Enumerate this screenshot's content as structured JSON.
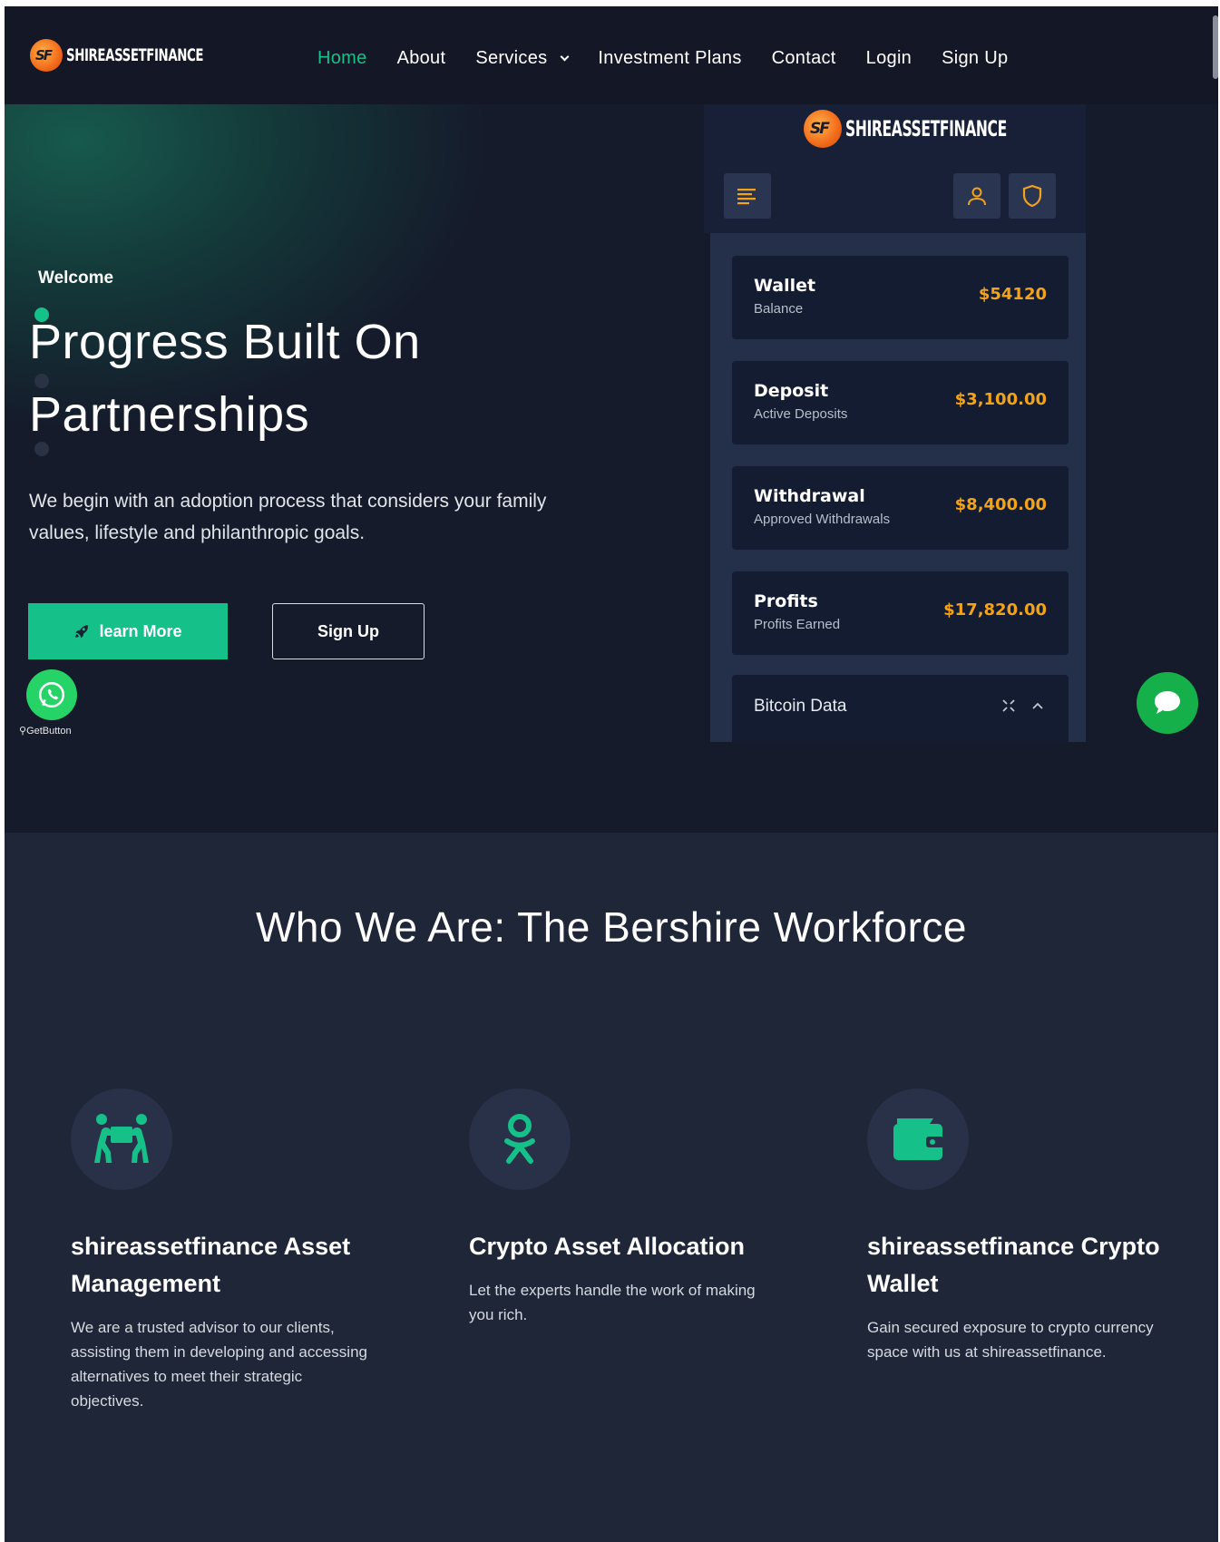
{
  "brand": {
    "name": "SHIREASSETFINANCE"
  },
  "nav": {
    "items": [
      {
        "label": "Home",
        "active": true
      },
      {
        "label": "About"
      },
      {
        "label": "Services",
        "dropdown": true
      },
      {
        "label": "Investment Plans"
      },
      {
        "label": "Contact"
      },
      {
        "label": "Login"
      },
      {
        "label": "Sign Up"
      }
    ]
  },
  "hero": {
    "welcome": "Welcome",
    "title_line1": "Progress Built On",
    "title_line2": "Partnerships",
    "subtitle": "We begin with an adoption process that considers your family values, lifestyle and philanthropic goals.",
    "learn_more_label": "learn More",
    "sign_up_label": "Sign Up",
    "getbutton_label": "GetButton"
  },
  "dashboard": {
    "brand": "SHIREASSETFINANCE",
    "cards": [
      {
        "title": "Wallet",
        "subtitle": "Balance",
        "value": "$54120"
      },
      {
        "title": "Deposit",
        "subtitle": "Active Deposits",
        "value": "$3,100.00"
      },
      {
        "title": "Withdrawal",
        "subtitle": "Approved Withdrawals",
        "value": "$8,400.00"
      },
      {
        "title": "Profits",
        "subtitle": "Profits Earned",
        "value": "$17,820.00"
      }
    ],
    "bitcoin_title": "Bitcoin Data"
  },
  "who": {
    "title": "Who We Are: The Bershire Workforce",
    "features": [
      {
        "icon": "people-carry-icon",
        "title": "shireassetfinance Asset Management",
        "text": "We are a trusted advisor to our clients, assisting them in developing and accessing alternatives to meet their strategic objectives."
      },
      {
        "icon": "odnoklassniki-icon",
        "title": "Crypto Asset Allocation",
        "text": "Let the experts handle the work of making you rich."
      },
      {
        "icon": "wallet-icon",
        "title": "shireassetfinance Crypto Wallet",
        "text": "Gain secured exposure to crypto currency space with us at shireassetfinance."
      }
    ]
  },
  "colors": {
    "accent": "#16c089",
    "gold": "#f3a319",
    "bg": "#1f2638",
    "header": "#141826"
  }
}
